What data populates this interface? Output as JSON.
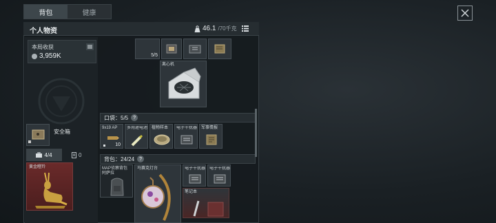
{
  "tabs": [
    "背包",
    "健康"
  ],
  "header": {
    "title": "个人物资",
    "weight": "46.1",
    "weight_max": "/70千克"
  },
  "harvest": {
    "title": "本局收获",
    "value": "3,959K"
  },
  "safe_box": {
    "label": "安全箱"
  },
  "counters": {
    "tools": "4/4",
    "cards": "0"
  },
  "left_item": {
    "label": "黄金瞪羚"
  },
  "top_grid": {
    "count": "5/5",
    "centrifuge_label": "离心机"
  },
  "pocket": {
    "title": "口袋：5/5",
    "items": [
      {
        "label": "9x19 AP",
        "count": "10"
      },
      {
        "label": "多用途电池"
      },
      {
        "label": "植物样本"
      },
      {
        "label": "电子干扰器"
      },
      {
        "label": "军事情报"
      }
    ]
  },
  "backpack": {
    "title": "背包：24/24",
    "items": [
      {
        "label": "MAP侦察背包 阿萨拉"
      },
      {
        "label": "马赛克灯台"
      },
      {
        "label": "电子干扰器"
      },
      {
        "label": "电子干扰器"
      },
      {
        "label": "笔记本"
      }
    ]
  },
  "colors": {
    "rarity_red": "#6a2a2a",
    "gold": "#c9a040"
  }
}
